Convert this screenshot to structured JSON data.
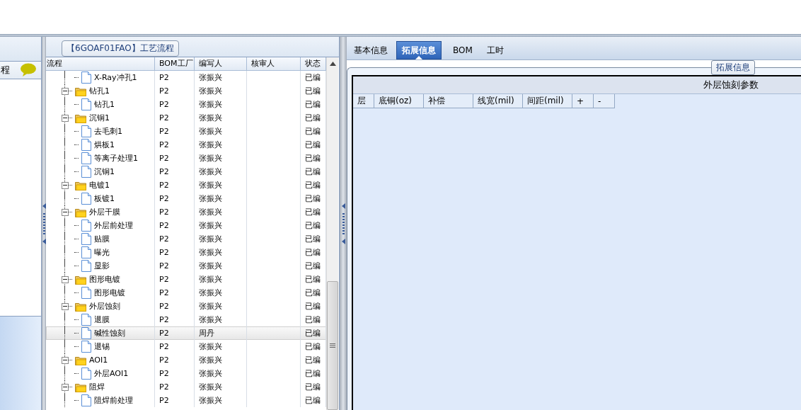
{
  "left_panel": {
    "header": "程"
  },
  "flow_panel": {
    "title": "【6GOAF01FAO】工艺流程",
    "columns": [
      "流程",
      "BOM工厂",
      "编写人",
      "核审人",
      "状态"
    ],
    "rows": [
      {
        "kind": "leaf",
        "name": "X-Ray冲孔1",
        "plant": "P2",
        "author": "张振兴",
        "status": "已编",
        "selected": false
      },
      {
        "kind": "folder",
        "name": "钻孔1",
        "plant": "P2",
        "author": "张振兴",
        "status": "已编",
        "selected": false,
        "expanded": true,
        "children": [
          {
            "kind": "leaf",
            "name": "钻孔1",
            "plant": "P2",
            "author": "张振兴",
            "status": "已编",
            "selected": false
          }
        ]
      },
      {
        "kind": "folder",
        "name": "沉铜1",
        "plant": "P2",
        "author": "张振兴",
        "status": "已编",
        "selected": false,
        "expanded": true,
        "children": [
          {
            "kind": "leaf",
            "name": "去毛刺1",
            "plant": "P2",
            "author": "张振兴",
            "status": "已编",
            "selected": false
          },
          {
            "kind": "leaf",
            "name": "烘板1",
            "plant": "P2",
            "author": "张振兴",
            "status": "已编",
            "selected": false
          },
          {
            "kind": "leaf",
            "name": "等离子处理1",
            "plant": "P2",
            "author": "张振兴",
            "status": "已编",
            "selected": false
          },
          {
            "kind": "leaf",
            "name": "沉铜1",
            "plant": "P2",
            "author": "张振兴",
            "status": "已编",
            "selected": false
          }
        ]
      },
      {
        "kind": "folder",
        "name": "电镀1",
        "plant": "P2",
        "author": "张振兴",
        "status": "已编",
        "selected": false,
        "expanded": true,
        "children": [
          {
            "kind": "leaf",
            "name": "板镀1",
            "plant": "P2",
            "author": "张振兴",
            "status": "已编",
            "selected": false
          }
        ]
      },
      {
        "kind": "folder",
        "name": "外层干膜",
        "plant": "P2",
        "author": "张振兴",
        "status": "已编",
        "selected": false,
        "expanded": true,
        "children": [
          {
            "kind": "leaf",
            "name": "外层前处理",
            "plant": "P2",
            "author": "张振兴",
            "status": "已编",
            "selected": false
          },
          {
            "kind": "leaf",
            "name": "贴膜",
            "plant": "P2",
            "author": "张振兴",
            "status": "已编",
            "selected": false
          },
          {
            "kind": "leaf",
            "name": "曝光",
            "plant": "P2",
            "author": "张振兴",
            "status": "已编",
            "selected": false
          },
          {
            "kind": "leaf",
            "name": "显影",
            "plant": "P2",
            "author": "张振兴",
            "status": "已编",
            "selected": false
          }
        ]
      },
      {
        "kind": "folder",
        "name": "图形电镀",
        "plant": "P2",
        "author": "张振兴",
        "status": "已编",
        "selected": false,
        "expanded": true,
        "children": [
          {
            "kind": "leaf",
            "name": "图形电镀",
            "plant": "P2",
            "author": "张振兴",
            "status": "已编",
            "selected": false
          }
        ]
      },
      {
        "kind": "folder",
        "name": "外层蚀刻",
        "plant": "P2",
        "author": "张振兴",
        "status": "已编",
        "selected": false,
        "expanded": true,
        "children": [
          {
            "kind": "leaf",
            "name": "退膜",
            "plant": "P2",
            "author": "张振兴",
            "status": "已编",
            "selected": false
          },
          {
            "kind": "leaf",
            "name": "碱性蚀刻",
            "plant": "P2",
            "author": "周丹",
            "status": "已编",
            "selected": true
          },
          {
            "kind": "leaf",
            "name": "退锡",
            "plant": "P2",
            "author": "张振兴",
            "status": "已编",
            "selected": false
          }
        ]
      },
      {
        "kind": "folder",
        "name": "AOI1",
        "plant": "P2",
        "author": "张振兴",
        "status": "已编",
        "selected": false,
        "expanded": true,
        "children": [
          {
            "kind": "leaf",
            "name": "外层AOI1",
            "plant": "P2",
            "author": "张振兴",
            "status": "已编",
            "selected": false
          }
        ]
      },
      {
        "kind": "folder",
        "name": "阻焊",
        "plant": "P2",
        "author": "张振兴",
        "status": "已编",
        "selected": false,
        "expanded": true,
        "children": [
          {
            "kind": "leaf",
            "name": "阻焊前处理",
            "plant": "P2",
            "author": "张振兴",
            "status": "已编",
            "selected": false
          }
        ]
      }
    ]
  },
  "detail_panel": {
    "tabs": [
      {
        "label": "基本信息",
        "selected": false
      },
      {
        "label": "拓展信息",
        "selected": true
      },
      {
        "label": "BOM",
        "selected": false
      },
      {
        "label": "工时",
        "selected": false
      }
    ],
    "group_title": "拓展信息",
    "table": {
      "title": "外层蚀刻参数",
      "columns": [
        "层",
        "底铜(oz)",
        "补偿",
        "线宽(mil)",
        "间距(mil)",
        "+",
        "-"
      ]
    }
  }
}
